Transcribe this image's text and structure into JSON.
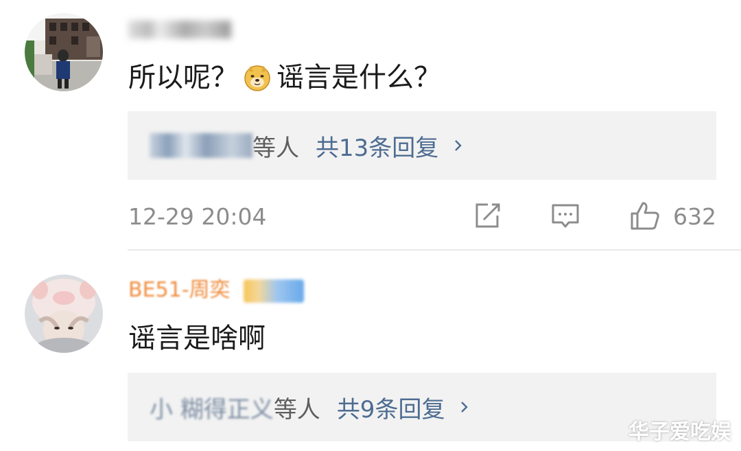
{
  "comments": [
    {
      "username": "",
      "content_before_emoji": "所以呢？",
      "emoji": "doge-emoji",
      "content_after_emoji": "谣言是什么？",
      "reply_preview": {
        "names_suffix": "等人",
        "reply_count_label": "共13条回复"
      },
      "timestamp": "12-29 20:04",
      "like_count": "632"
    },
    {
      "username": "BE51-周奕",
      "username_color": "#f08b3b",
      "content": "谣言是啥啊",
      "reply_preview": {
        "names_visible": "小 糊得正义",
        "names_suffix": "等人",
        "reply_count_label": "共9条回复"
      }
    }
  ],
  "watermark": "华子爱吃娱",
  "colors": {
    "link_blue": "#4d6c91",
    "meta_gray": "#8c8c8c",
    "reply_bg": "#f2f2f2",
    "username_orange": "#f08b3b"
  }
}
